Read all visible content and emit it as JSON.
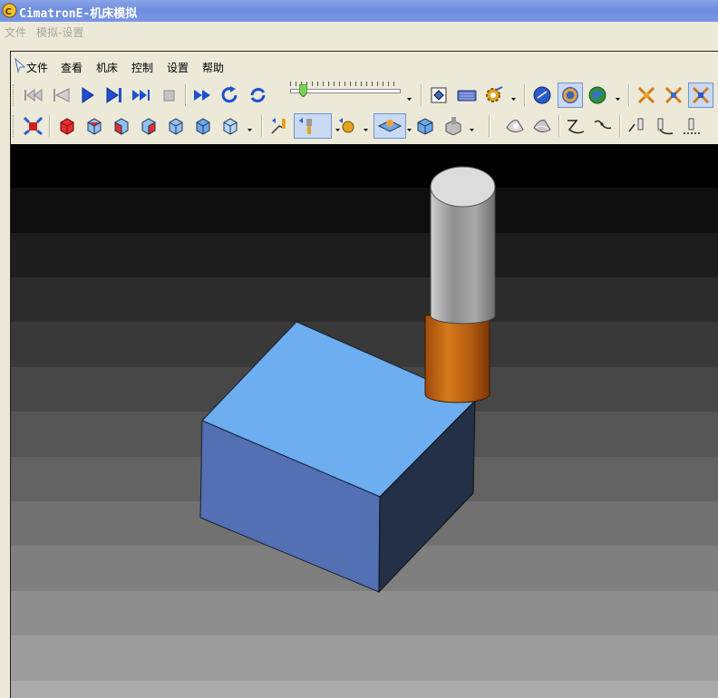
{
  "window": {
    "title": "CimatronE-机床模拟"
  },
  "outer_menu": [
    "文件",
    "模拟-设置"
  ],
  "inner_menu": [
    "文件",
    "查看",
    "机床",
    "控制",
    "设置",
    "帮助"
  ],
  "toolbar1": {
    "playback": [
      "rewind-to-start-icon",
      "step-back-icon",
      "play-icon",
      "step-forward-icon",
      "skip-to-end-icon",
      "stop-icon"
    ],
    "actions": [
      "fast-forward-icon",
      "rotate-view-icon",
      "refresh-icon"
    ],
    "speed_slider": {
      "label": "simulation-speed",
      "value": 0.1
    },
    "tools": [
      "machine-view-icon",
      "keyboard-icon",
      "settings-gear-icon"
    ],
    "render": [
      "blue-disc-icon",
      "orange-ring-icon",
      "globe-icon"
    ],
    "layout": [
      "split-view-icon",
      "multi-view-icon",
      "active-view-icon"
    ]
  },
  "toolbar2": {
    "views": [
      "fit-all-icon",
      "view-cube-front-icon",
      "view-cube-iso-icon",
      "view-cube-right-icon",
      "view-cube-left-icon",
      "view-cube-top-icon",
      "view-cube-back-icon",
      "view-cube-bottom-icon"
    ],
    "tool_display": [
      "tool-path-icon",
      "tool-holder-icon",
      "tool-rotate-icon",
      "stock-display-icon",
      "part-display-icon",
      "machine-display-icon"
    ],
    "shading": [
      "wireframe-shade-icon",
      "smooth-shade-icon"
    ],
    "paths": [
      "curve-path-icon",
      "arc-path-icon"
    ],
    "probes": [
      "probe-tool-icon",
      "probe-path-icon",
      "probe-trace-icon"
    ]
  },
  "colors": {
    "block_top": "#6daef0",
    "block_front": "#5270b3",
    "block_side": "#233047",
    "holder_gray": "#9c9c9c",
    "tool_orange": "#c8650f",
    "bg_top": "#000000",
    "bg_bottom": "#b8b8b8"
  }
}
